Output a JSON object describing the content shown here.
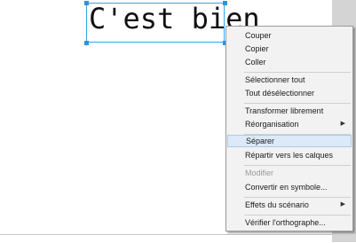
{
  "canvas": {
    "text": "C'est bien"
  },
  "context_menu": {
    "items": [
      {
        "label": "Couper",
        "enabled": true,
        "submenu": false,
        "highlighted": false
      },
      {
        "label": "Copier",
        "enabled": true,
        "submenu": false,
        "highlighted": false
      },
      {
        "label": "Coller",
        "enabled": true,
        "submenu": false,
        "highlighted": false
      },
      {
        "label": "Sélectionner tout",
        "enabled": true,
        "submenu": false,
        "highlighted": false
      },
      {
        "label": "Tout désélectionner",
        "enabled": true,
        "submenu": false,
        "highlighted": false
      },
      {
        "label": "Transformer librement",
        "enabled": true,
        "submenu": false,
        "highlighted": false
      },
      {
        "label": "Réorganisation",
        "enabled": true,
        "submenu": true,
        "highlighted": false
      },
      {
        "label": "Séparer",
        "enabled": true,
        "submenu": false,
        "highlighted": true
      },
      {
        "label": "Répartir vers les calques",
        "enabled": true,
        "submenu": false,
        "highlighted": false
      },
      {
        "label": "Modifier",
        "enabled": false,
        "submenu": false,
        "highlighted": false
      },
      {
        "label": "Convertir en symbole...",
        "enabled": true,
        "submenu": false,
        "highlighted": false
      },
      {
        "label": "Effets du scénario",
        "enabled": true,
        "submenu": true,
        "highlighted": false
      },
      {
        "label": "Vérifier l'orthographe...",
        "enabled": true,
        "submenu": false,
        "highlighted": false
      }
    ],
    "submenu_arrow": "▶"
  },
  "colors": {
    "selection": "#33a6e6",
    "menu_highlight": "#dce9f8",
    "menu_background": "#f2f2f2"
  }
}
